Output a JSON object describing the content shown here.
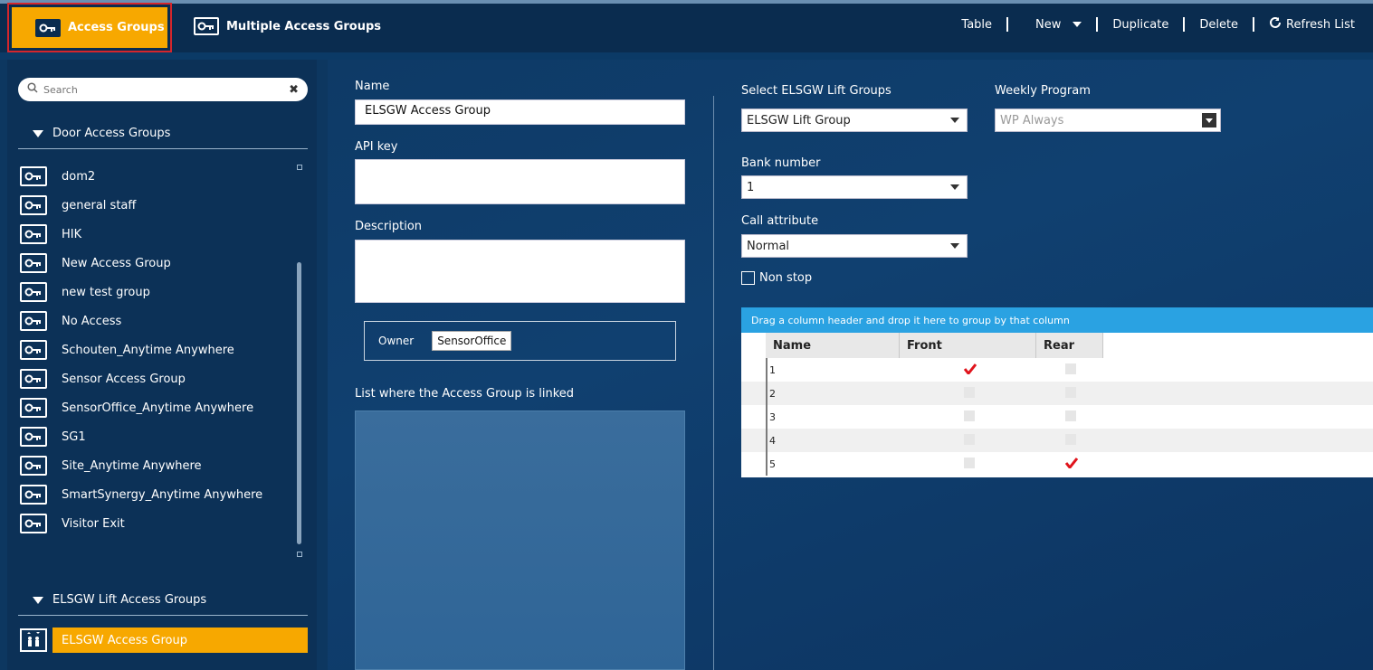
{
  "topbar": {
    "tab_access_groups": "Access Groups",
    "tab_multiple_access_groups": "Multiple Access Groups",
    "toolbar": {
      "table": "Table",
      "new": "New",
      "duplicate": "Duplicate",
      "delete": "Delete",
      "refresh": "Refresh List"
    }
  },
  "sidebar": {
    "search_placeholder": "Search",
    "door_group_title": "Door Access Groups",
    "door_items": [
      "dom2",
      "general staff",
      "HIK",
      "New Access Group",
      "new test group",
      "No Access",
      "Schouten_Anytime Anywhere",
      "Sensor Access Group",
      "SensorOffice_Anytime Anywhere",
      "SG1",
      "Site_Anytime Anywhere",
      "SmartSynergy_Anytime Anywhere",
      "Visitor Exit"
    ],
    "lift_group_title": "ELSGW Lift Access Groups",
    "lift_items": [
      "ELSGW Access Group"
    ]
  },
  "form": {
    "name_label": "Name",
    "name_value": "ELSGW Access Group",
    "api_key_label": "API key",
    "api_key_value": "",
    "description_label": "Description",
    "description_value": "",
    "owner_label": "Owner",
    "owner_value": "SensorOffice",
    "linked_label": "List where the Access Group is linked"
  },
  "lift": {
    "select_label": "Select ELSGW Lift Groups",
    "select_value": "ELSGW Lift Group",
    "weekly_label": "Weekly Program",
    "weekly_value": "WP Always",
    "bank_label": "Bank number",
    "bank_value": "1",
    "call_label": "Call attribute",
    "call_value": "Normal",
    "nonstop_label": "Non stop",
    "nonstop_checked": false
  },
  "grid": {
    "banner": "Drag a column header and drop it here to group by that column",
    "columns": [
      "Name",
      "Front",
      "Rear"
    ],
    "rows": [
      {
        "name": "1",
        "front": true,
        "rear": false
      },
      {
        "name": "2",
        "front": false,
        "rear": false
      },
      {
        "name": "3",
        "front": false,
        "rear": false
      },
      {
        "name": "4",
        "front": false,
        "rear": false
      },
      {
        "name": "5",
        "front": false,
        "rear": true
      }
    ]
  },
  "colors": {
    "accent": "#f7a800",
    "check": "#e0141c",
    "banner": "#2aa2e2",
    "background": "#0d3760"
  }
}
